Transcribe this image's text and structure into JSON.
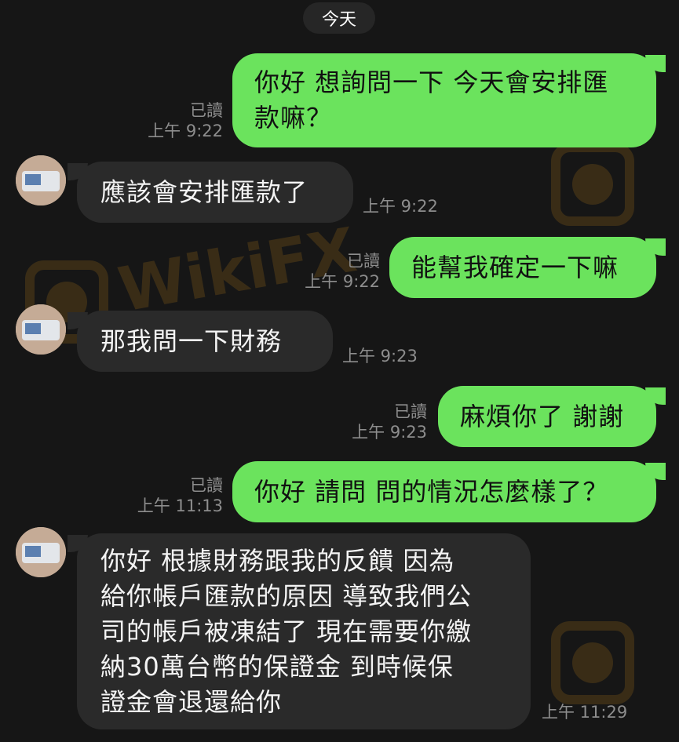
{
  "date_label": "今天",
  "messages": [
    {
      "text": "你好 想詢問一下 今天會安排匯\n款嘛？",
      "read": "已讀",
      "time": "上午 9:22"
    },
    {
      "text": "應該會安排匯款了",
      "time": "上午 9:22"
    },
    {
      "text": "能幫我確定一下嘛",
      "read": "已讀",
      "time": "上午 9:22"
    },
    {
      "text": "那我問一下財務",
      "time": "上午 9:23"
    },
    {
      "text": "麻煩你了 謝謝",
      "read": "已讀",
      "time": "上午 9:23"
    },
    {
      "text": "你好 請問 問的情況怎麼樣了？",
      "read": "已讀",
      "time": "上午 11:13"
    },
    {
      "text": "你好 根據財務跟我的反饋 因為\n給你帳戶匯款的原因 導致我們公\n司的帳戶被凍結了 現在需要你繳\n納30萬台幣的保證金 到時候保\n證金會退還給你",
      "time": "上午 11:29"
    }
  ],
  "watermark": {
    "text": "WikiFX"
  },
  "colors": {
    "outgoing": "#6be35d",
    "incoming": "#2a2a2a",
    "background": "#161616",
    "meta": "#8d8d8d"
  }
}
